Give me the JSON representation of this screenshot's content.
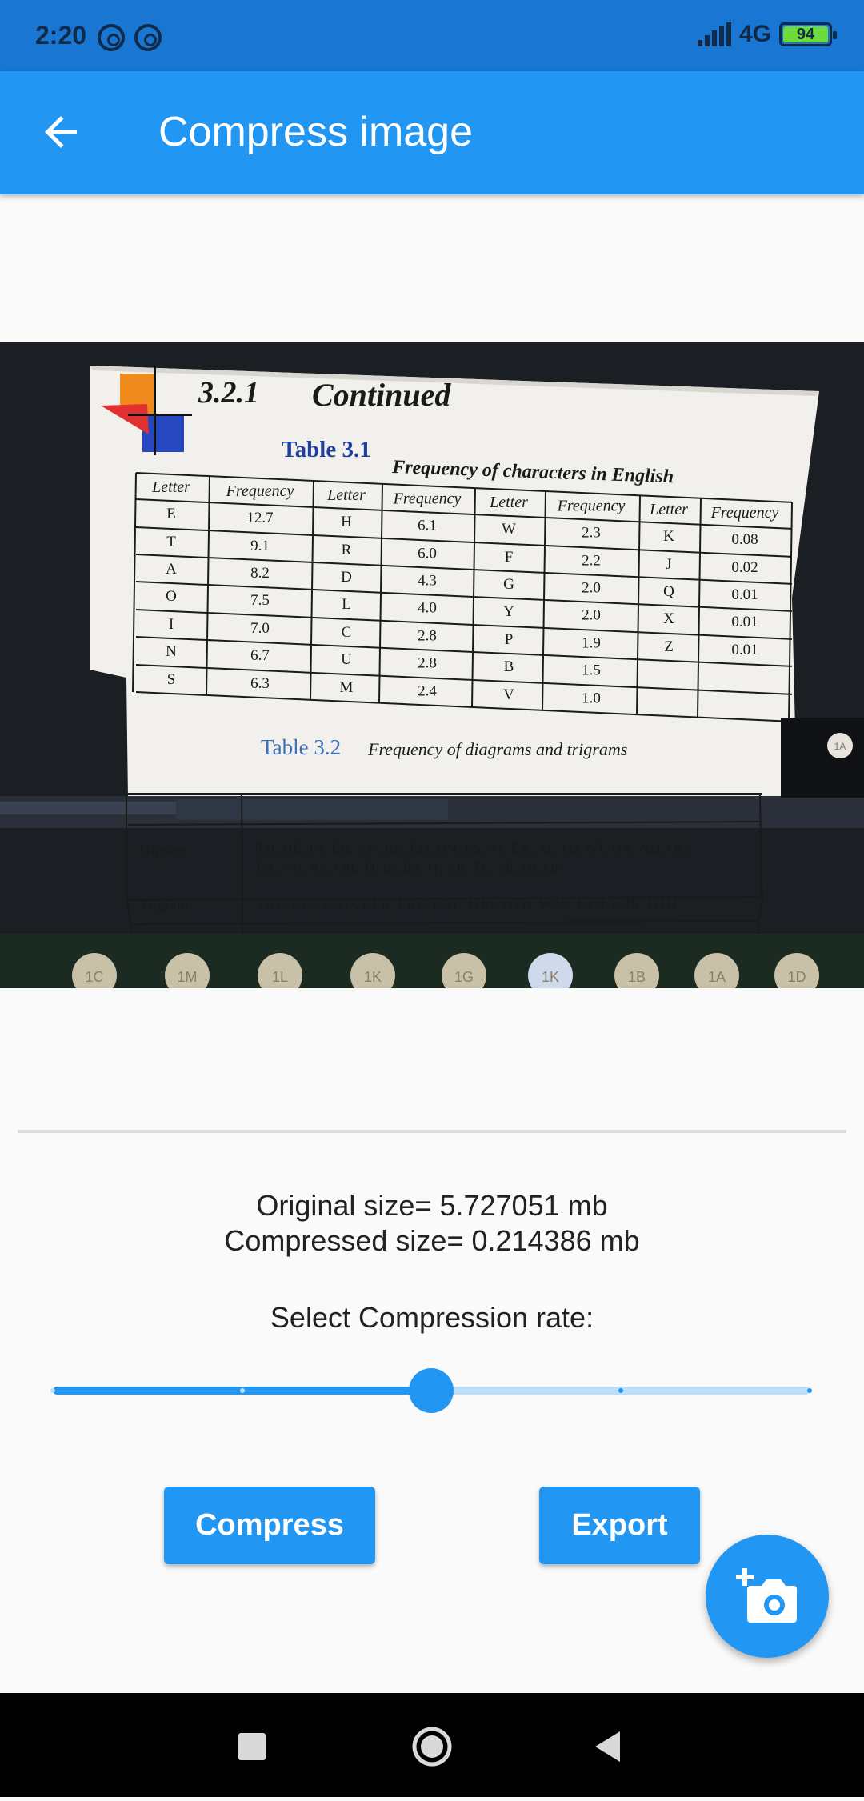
{
  "status_bar": {
    "time": "2:20",
    "network": "4G",
    "battery_level": "94",
    "colors": {
      "bar": "#1976d2",
      "icons": "#102a4a",
      "battery": "#6ddb3a"
    }
  },
  "app_bar": {
    "title": "Compress image",
    "back_icon": "arrow-left-icon",
    "color": "#2196f3"
  },
  "photo": {
    "section_heading": "3.2.1",
    "section_title": "Continued",
    "table1": {
      "label": "Table 3.1",
      "caption": "Frequency of characters in English",
      "headers": [
        "Letter",
        "Frequency",
        "Letter",
        "Frequency",
        "Letter",
        "Frequency",
        "Letter",
        "Frequency"
      ],
      "rows": [
        [
          "E",
          "12.7",
          "H",
          "6.1",
          "W",
          "2.3",
          "K",
          "0.08"
        ],
        [
          "T",
          "9.1",
          "R",
          "6.0",
          "F",
          "2.2",
          "J",
          "0.02"
        ],
        [
          "A",
          "8.2",
          "D",
          "4.3",
          "G",
          "2.0",
          "Q",
          "0.01"
        ],
        [
          "O",
          "7.5",
          "L",
          "4.0",
          "Y",
          "2.0",
          "X",
          "0.01"
        ],
        [
          "I",
          "7.0",
          "C",
          "2.8",
          "P",
          "1.9",
          "Z",
          "0.01"
        ],
        [
          "N",
          "6.7",
          "U",
          "2.8",
          "B",
          "1.5",
          "",
          ""
        ],
        [
          "S",
          "6.3",
          "M",
          "2.4",
          "V",
          "1.0",
          "",
          ""
        ]
      ]
    },
    "table2": {
      "label": "Table 3.2",
      "caption": "Frequency of diagrams and trigrams",
      "rows": [
        {
          "type": "Digram",
          "line1": "TH, HE, IN, ER, AN, RE, ED, ON, ES, ST, EN, AT, TO, NT, HA, ND, OU,",
          "line2": "EA, NG, AS, OR, TI, IS, ET, IT, AR, TE, SE, HI, OF"
        },
        {
          "type": "Trigram",
          "line1": "THE, ING, AND, HER, ERE, ENT, THA, NTH, WAS, ETH, FOR, DTH",
          "line2": ""
        }
      ]
    },
    "participants": [
      "1C",
      "1M",
      "1L",
      "1K",
      "1G",
      "1K",
      "1B",
      "1A",
      "1D"
    ],
    "side_avatar": "1A"
  },
  "info": {
    "original_size": "Original size= 5.727051 mb",
    "compressed_size": "Compressed size= 0.214386 mb",
    "slider_label": "Select Compression rate:"
  },
  "slider": {
    "value": 0.5,
    "divisions": 4,
    "active_color": "#2196f3",
    "inactive_color": "#bbdefb"
  },
  "buttons": {
    "compress_label": "Compress",
    "export_label": "Export"
  },
  "fab": {
    "icon": "add-photo-camera-icon"
  },
  "nav": {
    "icons": [
      "square-recent-icon",
      "circle-home-icon",
      "triangle-back-icon"
    ]
  }
}
